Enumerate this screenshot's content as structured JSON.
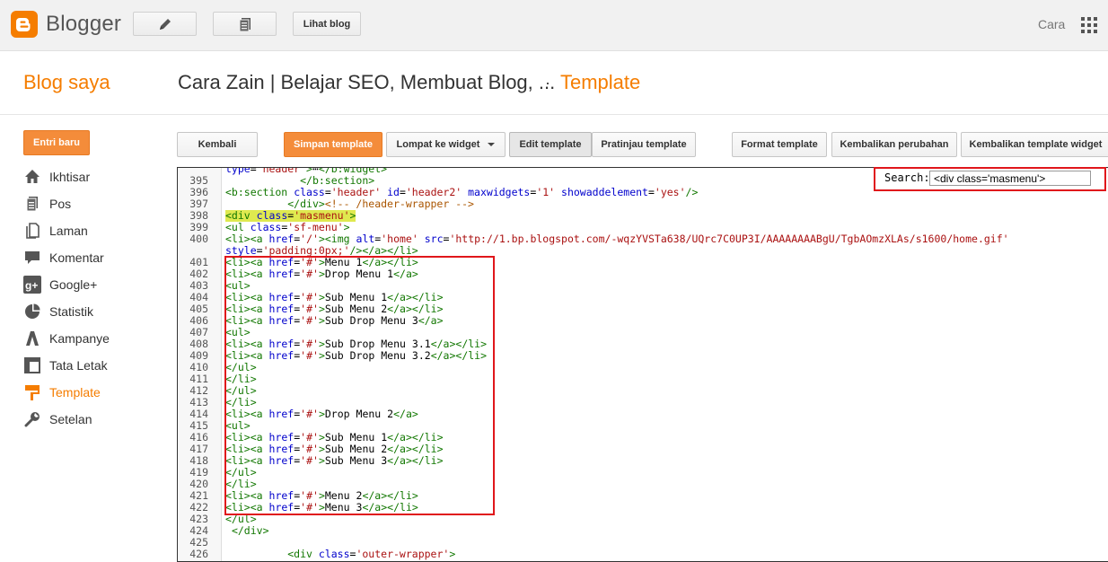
{
  "topbar": {
    "brand": "Blogger",
    "view_blog": "Lihat blog",
    "user": "Cara"
  },
  "header": {
    "blog_saya": "Blog saya",
    "blog_title": "Cara Zain | Belajar SEO, Membuat Blog, ...",
    "separator": "·",
    "page": "Template"
  },
  "sidebar": {
    "new_post": "Entri baru",
    "items": [
      {
        "label": "Ikhtisar",
        "icon": "home-icon"
      },
      {
        "label": "Pos",
        "icon": "posts-icon"
      },
      {
        "label": "Laman",
        "icon": "pages-icon"
      },
      {
        "label": "Komentar",
        "icon": "comment-icon"
      },
      {
        "label": "Google+",
        "icon": "google-plus-icon"
      },
      {
        "label": "Statistik",
        "icon": "stats-icon"
      },
      {
        "label": "Kampanye",
        "icon": "campaign-icon"
      },
      {
        "label": "Tata Letak",
        "icon": "layout-icon"
      },
      {
        "label": "Template",
        "icon": "template-icon",
        "active": true
      },
      {
        "label": "Setelan",
        "icon": "settings-icon"
      }
    ]
  },
  "toolbar": {
    "back": "Kembali",
    "save": "Simpan template",
    "jump": "Lompat ke widget",
    "edit": "Edit template",
    "preview": "Pratinjau template",
    "format": "Format template",
    "revert": "Kembalikan perubahan",
    "restore": "Kembalikan template widget"
  },
  "search": {
    "label": "Search:",
    "value": "<div class='masmenu'>"
  },
  "colors": {
    "accent": "#f57d00",
    "highlight_box": "#e0161b",
    "match_highlight": "#dfe94f"
  },
  "code": {
    "partial_top": "type='header'>⋯</b:widget>",
    "lines": [
      {
        "n": "395",
        "text": "            </b:section>"
      },
      {
        "n": "396",
        "text": "<b:section class='header' id='header2' maxwidgets='1' showaddelement='yes'/>"
      },
      {
        "n": "397",
        "text": "          </div><!-- /header-wrapper -->"
      },
      {
        "n": "398",
        "text": "<div class='masmenu'>",
        "highlight": true
      },
      {
        "n": "399",
        "text": "<ul class='sf-menu'>"
      },
      {
        "n": "400",
        "text": "<li><a href='/'><img alt='home' src='http://1.bp.blogspot.com/-wqzYVSTa638/UQrc7C0UP3I/AAAAAAAABgU/TgbAOmzXLAs/s1600/home.gif'"
      },
      {
        "n": "",
        "text": "style='padding:0px;'/></a></li>"
      },
      {
        "n": "401",
        "text": "<li><a href='#'>Menu 1</a></li>"
      },
      {
        "n": "402",
        "text": "<li><a href='#'>Drop Menu 1</a>"
      },
      {
        "n": "403",
        "text": "<ul>"
      },
      {
        "n": "404",
        "text": "<li><a href='#'>Sub Menu 1</a></li>"
      },
      {
        "n": "405",
        "text": "<li><a href='#'>Sub Menu 2</a></li>"
      },
      {
        "n": "406",
        "text": "<li><a href='#'>Sub Drop Menu 3</a>"
      },
      {
        "n": "407",
        "text": "<ul>"
      },
      {
        "n": "408",
        "text": "<li><a href='#'>Sub Drop Menu 3.1</a></li>"
      },
      {
        "n": "409",
        "text": "<li><a href='#'>Sub Drop Menu 3.2</a></li>"
      },
      {
        "n": "410",
        "text": "</ul>"
      },
      {
        "n": "411",
        "text": "</li>"
      },
      {
        "n": "412",
        "text": "</ul>"
      },
      {
        "n": "413",
        "text": "</li>"
      },
      {
        "n": "414",
        "text": "<li><a href='#'>Drop Menu 2</a>"
      },
      {
        "n": "415",
        "text": "<ul>"
      },
      {
        "n": "416",
        "text": "<li><a href='#'>Sub Menu 1</a></li>"
      },
      {
        "n": "417",
        "text": "<li><a href='#'>Sub Menu 2</a></li>"
      },
      {
        "n": "418",
        "text": "<li><a href='#'>Sub Menu 3</a></li>"
      },
      {
        "n": "419",
        "text": "</ul>"
      },
      {
        "n": "420",
        "text": "</li>"
      },
      {
        "n": "421",
        "text": "<li><a href='#'>Menu 2</a></li>"
      },
      {
        "n": "422",
        "text": "<li><a href='#'>Menu 3</a></li>"
      },
      {
        "n": "423",
        "text": "</ul>"
      },
      {
        "n": "424",
        "text": " </div>"
      },
      {
        "n": "425",
        "text": ""
      },
      {
        "n": "426",
        "text": "          <div class='outer-wrapper'>"
      }
    ]
  }
}
